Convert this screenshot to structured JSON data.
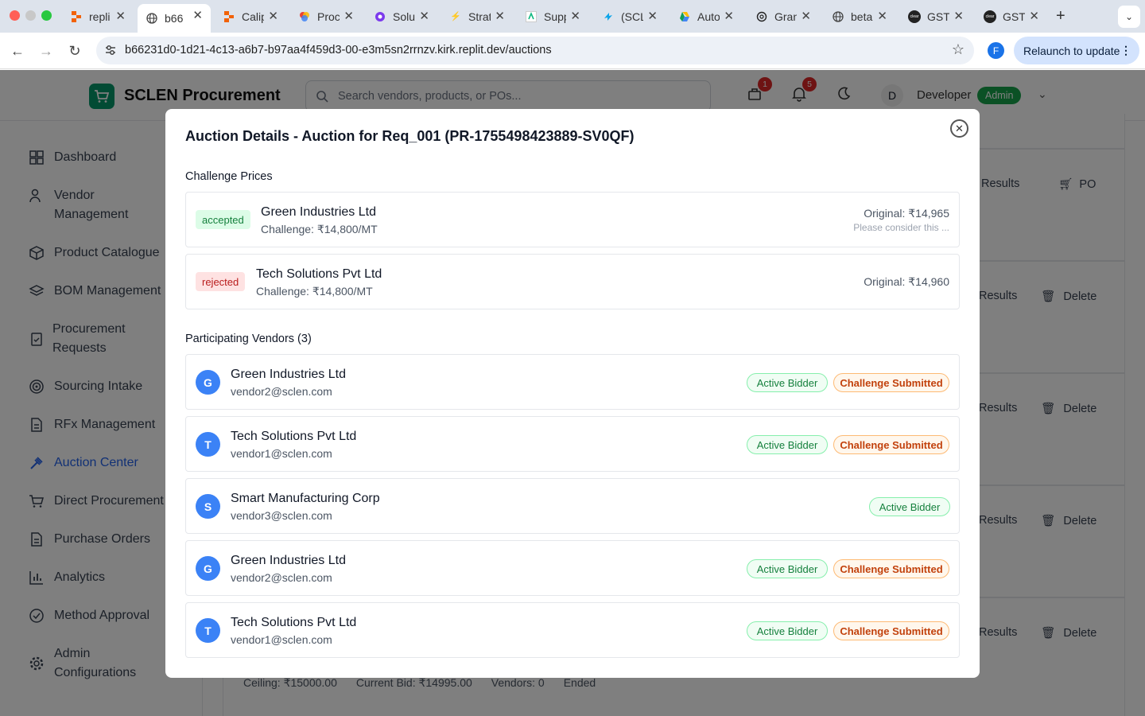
{
  "browser": {
    "tabs": [
      {
        "label": "repli"
      },
      {
        "label": "b66"
      },
      {
        "label": "Calip"
      },
      {
        "label": "Proc"
      },
      {
        "label": "Solu"
      },
      {
        "label": "Strat"
      },
      {
        "label": "Supp"
      },
      {
        "label": "(SCL"
      },
      {
        "label": "Auto"
      },
      {
        "label": "Gran"
      },
      {
        "label": "beta"
      },
      {
        "label": "GST"
      },
      {
        "label": "GST"
      }
    ],
    "url": "b66231d0-1d21-4c13-a6b7-b97aa4f459d3-00-e3m5sn2rrnzv.kirk.replit.dev/auctions",
    "profile_initial": "F",
    "relaunch_label": "Relaunch to update"
  },
  "app": {
    "brand": "SCLEN Procurement",
    "search_placeholder": "Search vendors, products, or POs...",
    "cart_count": "1",
    "notif_count": "5",
    "user_initial": "D",
    "user_name": "Developer",
    "user_role": "Admin"
  },
  "sidebar": {
    "items": [
      {
        "label": "Dashboard"
      },
      {
        "label": "Vendor Management"
      },
      {
        "label": "Product Catalogue"
      },
      {
        "label": "BOM Management"
      },
      {
        "label": "Procurement Requests"
      },
      {
        "label": "Sourcing Intake"
      },
      {
        "label": "RFx Management"
      },
      {
        "label": "Auction Center"
      },
      {
        "label": "Direct Procurement"
      },
      {
        "label": "Purchase Orders"
      },
      {
        "label": "Analytics"
      },
      {
        "label": "Method Approval"
      },
      {
        "label": "Admin Configurations"
      }
    ]
  },
  "background": {
    "results_label": "Results",
    "po_label": "PO",
    "delete_label": "Delete",
    "ceiling": "Ceiling: ₹15000.00",
    "current_bid": "Current Bid: ₹14995.00",
    "vendors": "Vendors: 0",
    "status": "Ended"
  },
  "modal": {
    "title": "Auction Details - Auction for Req_001 (PR-1755498423889-SV0QF)",
    "challenge_heading": "Challenge Prices",
    "challenges": [
      {
        "status": "accepted",
        "vendor": "Green Industries Ltd",
        "challenge": "Challenge: ₹14,800/MT",
        "original": "Original: ₹14,965",
        "note": "Please consider this ..."
      },
      {
        "status": "rejected",
        "vendor": "Tech Solutions Pvt Ltd",
        "challenge": "Challenge: ₹14,800/MT",
        "original": "Original: ₹14,960",
        "note": ""
      }
    ],
    "vendors_heading": "Participating Vendors (3)",
    "vendors": [
      {
        "initial": "G",
        "name": "Green Industries Ltd",
        "email": "vendor2@sclen.com",
        "badges": [
          "Active Bidder",
          "Challenge Submitted"
        ]
      },
      {
        "initial": "T",
        "name": "Tech Solutions Pvt Ltd",
        "email": "vendor1@sclen.com",
        "badges": [
          "Active Bidder",
          "Challenge Submitted"
        ]
      },
      {
        "initial": "S",
        "name": "Smart Manufacturing Corp",
        "email": "vendor3@sclen.com",
        "badges": [
          "Active Bidder"
        ]
      },
      {
        "initial": "G",
        "name": "Green Industries Ltd",
        "email": "vendor2@sclen.com",
        "badges": [
          "Active Bidder",
          "Challenge Submitted"
        ]
      },
      {
        "initial": "T",
        "name": "Tech Solutions Pvt Ltd",
        "email": "vendor1@sclen.com",
        "badges": [
          "Active Bidder",
          "Challenge Submitted"
        ]
      }
    ]
  }
}
